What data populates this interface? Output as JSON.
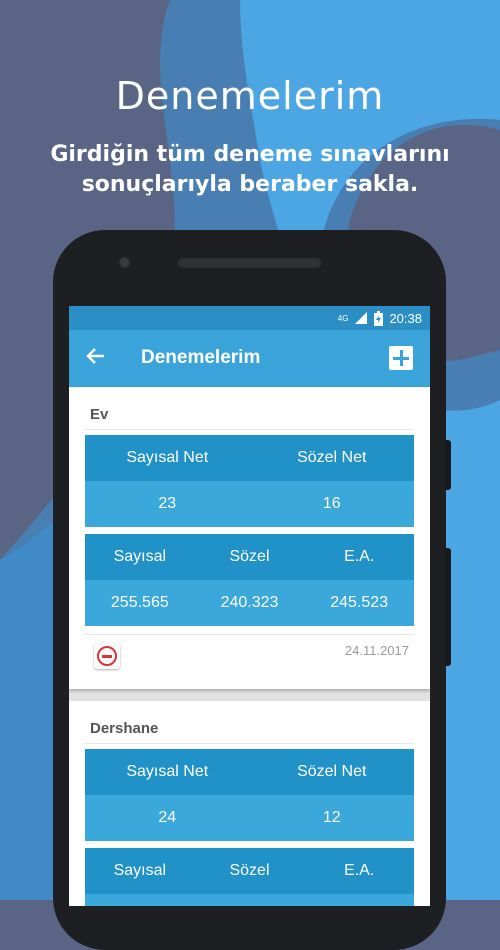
{
  "promo": {
    "title": "Denemelerim",
    "subtitle_line1": "Girdiğin tüm deneme sınavlarını",
    "subtitle_line2": "sonuçlarıyla beraber sakla."
  },
  "status_bar": {
    "network": "4G",
    "time": "20:38"
  },
  "toolbar": {
    "title": "Denemelerim",
    "back_icon": "arrow-left-icon",
    "add_icon": "plus-icon"
  },
  "colors": {
    "background": "#5a6585",
    "accent_blue": "#3aa3da",
    "status_blue": "#2b8fc6",
    "table_head": "#2092c8",
    "table_value": "#3aa8da",
    "delete_red": "#d6353b"
  },
  "cards": [
    {
      "title": "Ev",
      "net_headers": [
        "Sayısal Net",
        "Sözel Net"
      ],
      "net_values": [
        "23",
        "16"
      ],
      "score_headers": [
        "Sayısal",
        "Sözel",
        "E.A."
      ],
      "score_values": [
        "255.565",
        "240.323",
        "245.523"
      ],
      "date": "24.11.2017"
    },
    {
      "title": "Dershane",
      "net_headers": [
        "Sayısal Net",
        "Sözel Net"
      ],
      "net_values": [
        "24",
        "12"
      ],
      "score_headers": [
        "Sayısal",
        "Sözel",
        "E.A."
      ],
      "score_values": [
        "",
        "",
        ""
      ],
      "date": ""
    }
  ]
}
